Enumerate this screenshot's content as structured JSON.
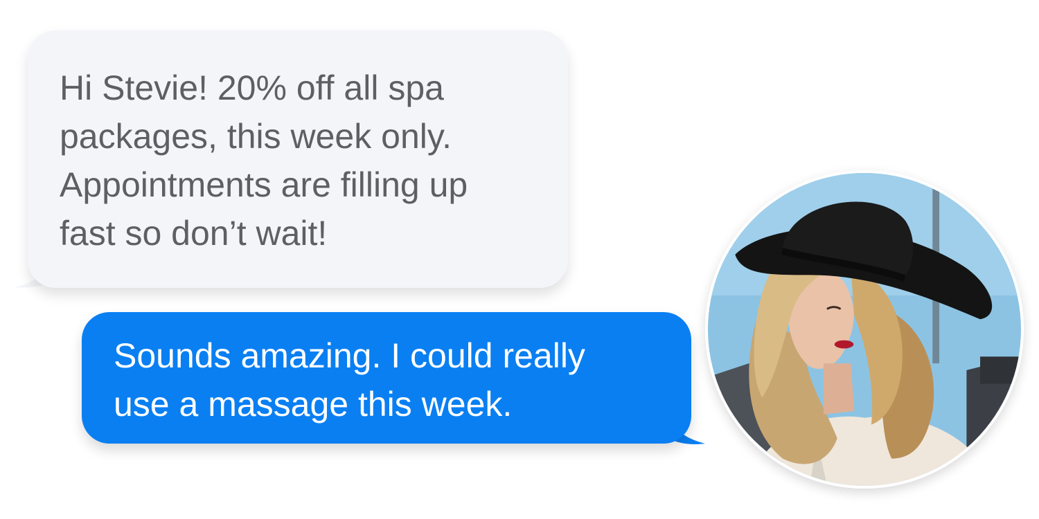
{
  "messages": {
    "incoming": {
      "text": "Hi Stevie! 20% off all spa\npackages, this week only.\nAppointments are filling up\nfast so don’t wait!"
    },
    "outgoing": {
      "text": "Sounds amazing. I could really\nuse a massage this week."
    }
  },
  "avatar": {
    "icon": "person-photo-avatar"
  },
  "colors": {
    "incoming_bubble": "#f4f5f9",
    "incoming_text": "#5e5f63",
    "outgoing_bubble": "#0a7ff2",
    "outgoing_text": "#ffffff"
  }
}
